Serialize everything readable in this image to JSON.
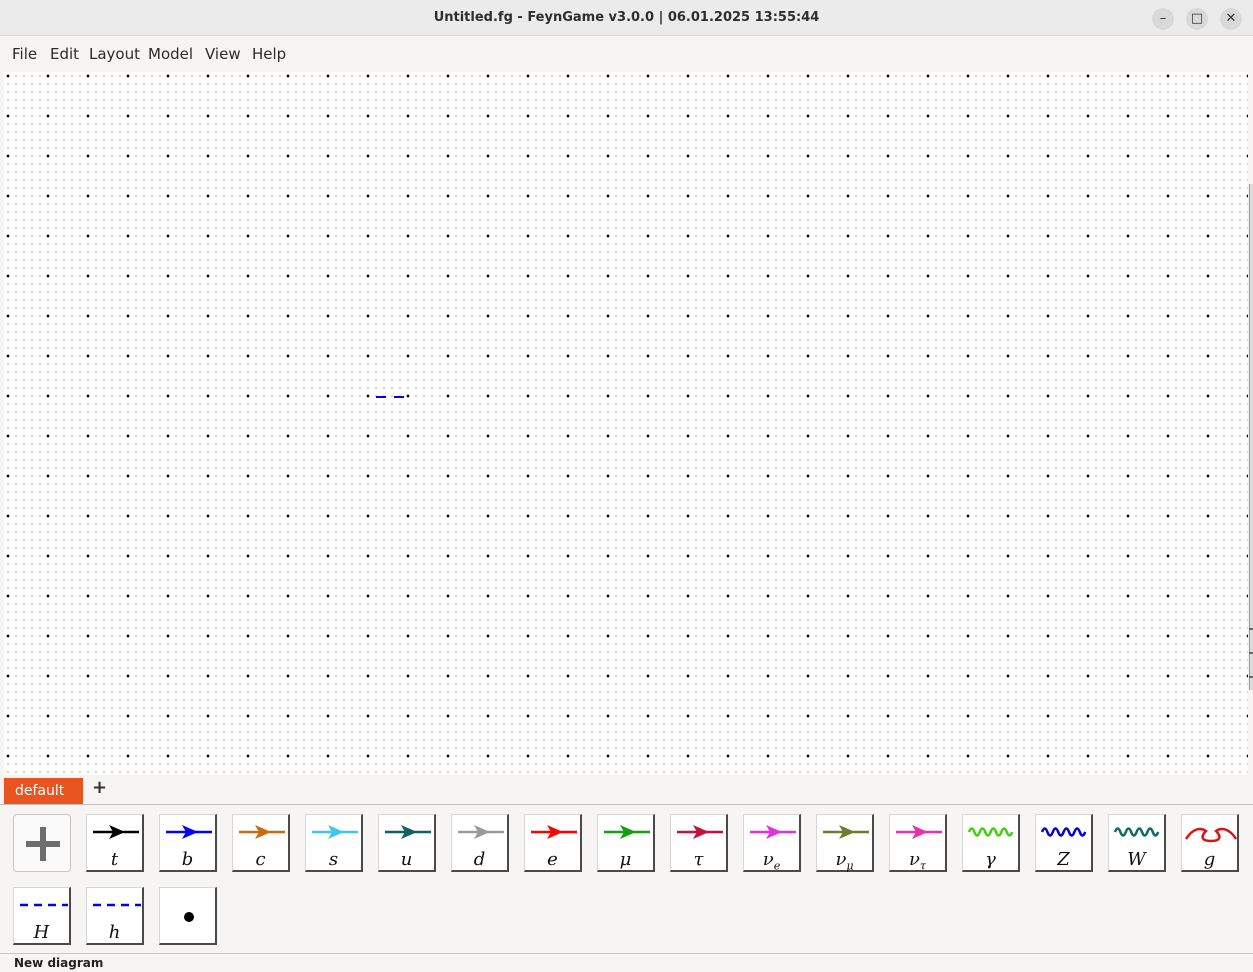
{
  "window": {
    "title": "Untitled.fg - FeynGame v3.0.0 | 06.01.2025 13:55:44",
    "minimize_glyph": "–",
    "maximize_glyph": "□",
    "close_glyph": "✕"
  },
  "menu": [
    "File",
    "Edit",
    "Layout",
    "Model",
    "View",
    "Help"
  ],
  "tabs": {
    "active": "default",
    "add_glyph": "+"
  },
  "palette": {
    "items": [
      {
        "name": "top-quark",
        "label": "t",
        "style": "arrow",
        "color": "#000000"
      },
      {
        "name": "bottom-quark",
        "label": "b",
        "style": "arrow",
        "color": "#0000ff"
      },
      {
        "name": "charm-quark",
        "label": "c",
        "style": "arrow",
        "color": "#cc6a14"
      },
      {
        "name": "strange-quark",
        "label": "s",
        "style": "arrow",
        "color": "#3fc6f0"
      },
      {
        "name": "up-quark",
        "label": "u",
        "style": "arrow",
        "color": "#0f6060"
      },
      {
        "name": "down-quark",
        "label": "d",
        "style": "arrow",
        "color": "#999999"
      },
      {
        "name": "electron",
        "label": "e",
        "style": "arrow",
        "color": "#ff0000"
      },
      {
        "name": "muon",
        "label": "μ",
        "style": "arrow",
        "color": "#12a012"
      },
      {
        "name": "tau",
        "label": "τ",
        "style": "arrow",
        "color": "#c8103c"
      },
      {
        "name": "electron-neutrino",
        "label": "ν",
        "sub": "e",
        "style": "arrow",
        "color": "#e033e0"
      },
      {
        "name": "muon-neutrino",
        "label": "ν",
        "sub": "μ",
        "style": "arrow",
        "color": "#6e7b30"
      },
      {
        "name": "tau-neutrino",
        "label": "ν",
        "sub": "τ",
        "style": "arrow",
        "color": "#e533a8"
      },
      {
        "name": "photon",
        "label": "γ",
        "style": "wave",
        "color": "#44cc11"
      },
      {
        "name": "z-boson",
        "label": "Z",
        "style": "wave",
        "color": "#0000dd"
      },
      {
        "name": "w-boson",
        "label": "W",
        "style": "wave",
        "color": "#0f6a60"
      },
      {
        "name": "gluon",
        "label": "g",
        "style": "gluon",
        "color": "#dd1111"
      },
      {
        "name": "higgs",
        "label": "H",
        "style": "dashed",
        "color": "#0000ee"
      },
      {
        "name": "ghost",
        "label": "h",
        "style": "dashed",
        "color": "#0000ee"
      },
      {
        "name": "vertex",
        "label": "",
        "style": "dot",
        "color": "#000000"
      }
    ]
  },
  "canvas": {
    "dashed_line_color": "#0000ee"
  },
  "status": "New diagram"
}
